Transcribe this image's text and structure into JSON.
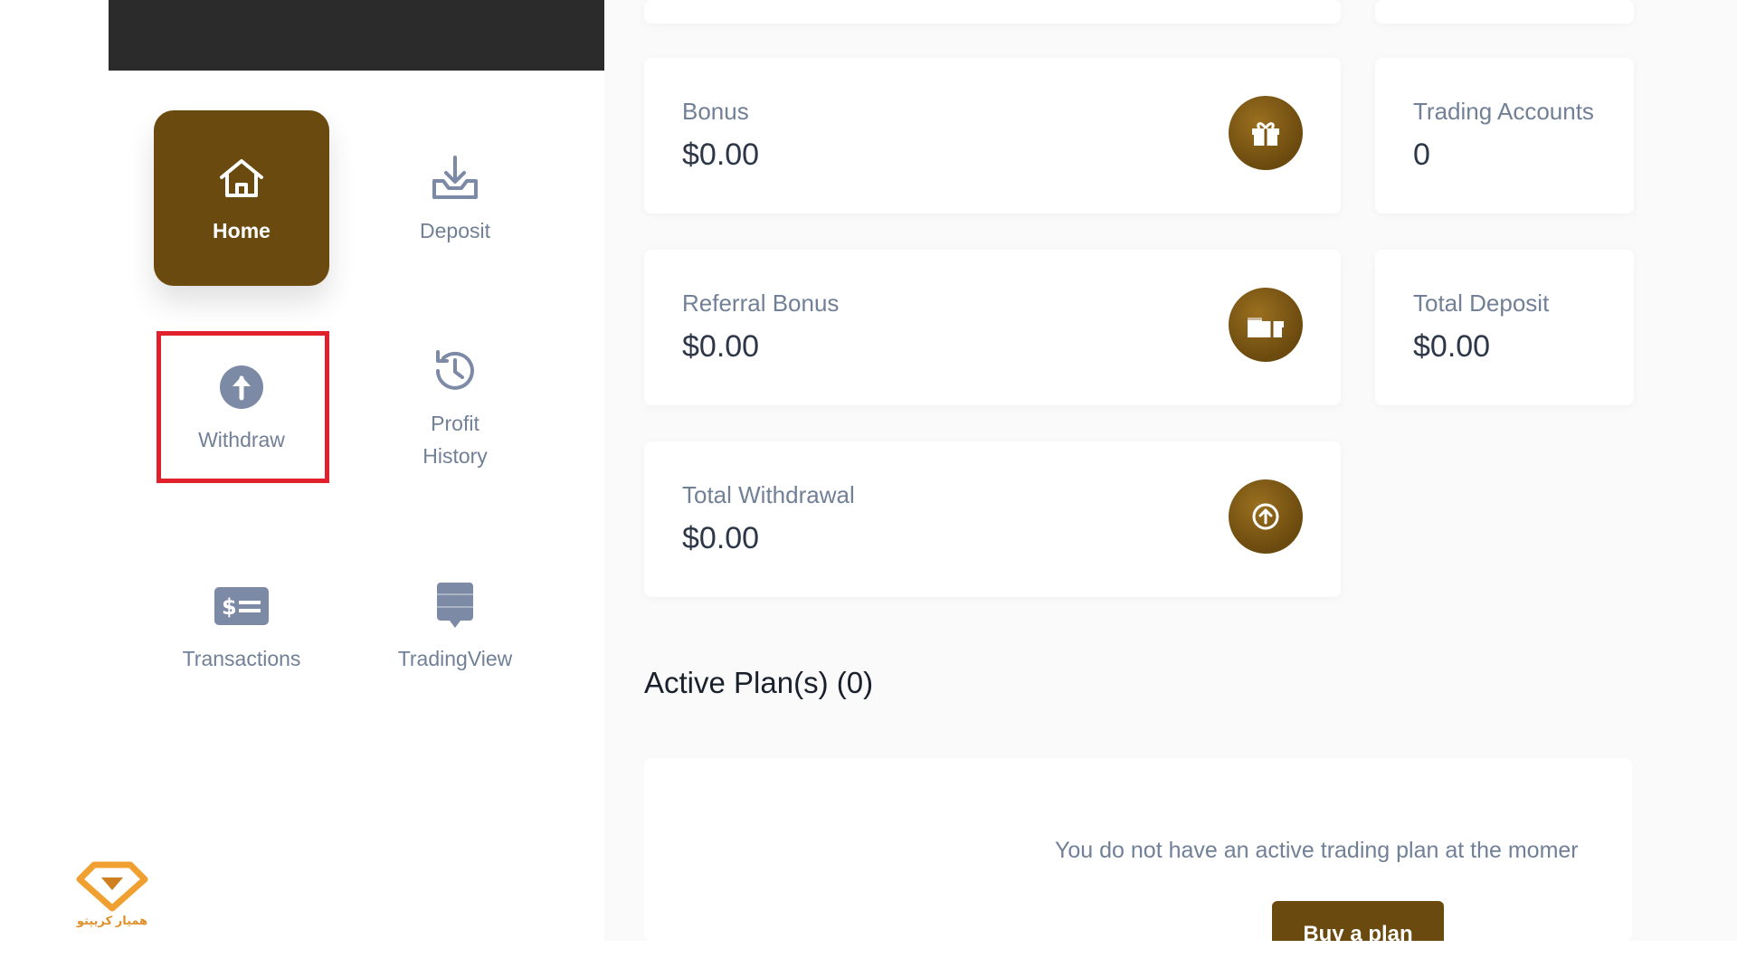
{
  "sidebar": {
    "items": [
      {
        "label": "Home",
        "icon": "home-icon",
        "active": true
      },
      {
        "label": "Deposit",
        "icon": "download-tray-icon",
        "active": false
      },
      {
        "label": "Withdraw",
        "icon": "arrow-up-circle-icon",
        "active": false
      },
      {
        "label": "Profit\nHistory",
        "icon": "history-clock-icon",
        "active": false
      },
      {
        "label": "Transactions",
        "icon": "dollar-bill-icon",
        "active": false
      },
      {
        "label": "TradingView",
        "icon": "chat-bubble-icon",
        "active": false
      }
    ]
  },
  "stats": {
    "bonus": {
      "label": "Bonus",
      "value": "$0.00",
      "icon": "gift-icon"
    },
    "trading_accounts": {
      "label": "Trading Accounts",
      "value": "0"
    },
    "referral_bonus": {
      "label": "Referral Bonus",
      "value": "$0.00",
      "icon": "gifts-icon"
    },
    "total_deposit": {
      "label": "Total Deposit",
      "value": "$0.00"
    },
    "total_withdrawal": {
      "label": "Total Withdrawal",
      "value": "$0.00",
      "icon": "arrow-up-circle-icon"
    }
  },
  "plans": {
    "title": "Active Plan(s) (0)",
    "empty_message": "You do not have an active trading plan at the momer",
    "buy_button": "Buy a plan"
  },
  "watermark": {
    "text": "همیار کریپتو"
  },
  "colors": {
    "accent": "#6b4a0f",
    "highlight": "#e0202a",
    "muted_text": "#718096",
    "icon_gray": "#7c8aa5"
  }
}
